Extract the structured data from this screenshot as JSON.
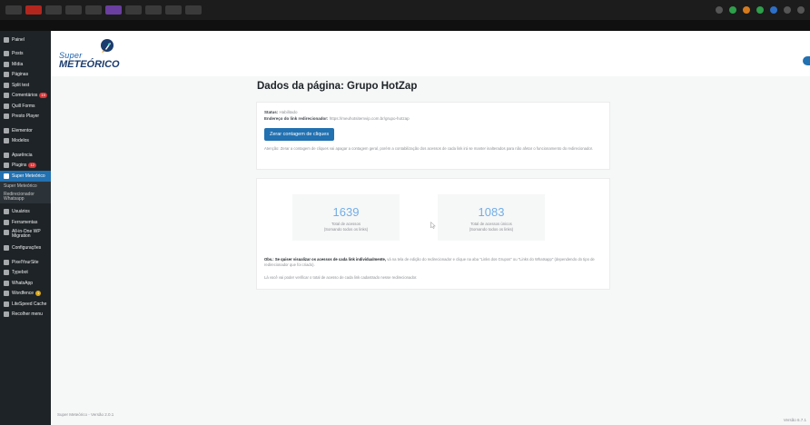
{
  "sidebar": {
    "items": [
      {
        "label": "Painel",
        "icon": "dashboard-icon"
      },
      {
        "label": "Posts",
        "icon": "pin-icon"
      },
      {
        "label": "Mídia",
        "icon": "media-icon"
      },
      {
        "label": "Páginas",
        "icon": "pages-icon"
      },
      {
        "label": "Split test",
        "icon": "split-icon"
      },
      {
        "label": "Comentários",
        "icon": "comment-icon",
        "badge": "19"
      },
      {
        "label": "Quill Forms",
        "icon": "form-icon"
      },
      {
        "label": "Presto Player",
        "icon": "play-icon"
      },
      {
        "label": "Elementor",
        "icon": "elementor-icon"
      },
      {
        "label": "Modelos",
        "icon": "folder-icon"
      },
      {
        "label": "Aparência",
        "icon": "brush-icon"
      },
      {
        "label": "Plugins",
        "icon": "plugin-icon",
        "badge": "12"
      },
      {
        "label": "Super Meteórico",
        "icon": "rocket-icon"
      },
      {
        "label": "Super Meteórico"
      },
      {
        "label": "Redirecionador Whatsapp"
      },
      {
        "label": "Usuários",
        "icon": "users-icon"
      },
      {
        "label": "Ferramentas",
        "icon": "tools-icon"
      },
      {
        "label": "All-in-One WP Migration",
        "icon": "migration-icon"
      },
      {
        "label": "Configurações",
        "icon": "settings-icon"
      },
      {
        "label": "PixelYourSite",
        "icon": "pixel-icon"
      },
      {
        "label": "Typebot",
        "icon": "bot-icon"
      },
      {
        "label": "WhatsApp",
        "icon": "whatsapp-icon"
      },
      {
        "label": "Wordfence",
        "icon": "shield-icon",
        "badge": "1"
      },
      {
        "label": "LiteSpeed Cache",
        "icon": "speed-icon"
      },
      {
        "label": "Recolher menu",
        "icon": "collapse-icon"
      }
    ]
  },
  "logo": {
    "top": "Super",
    "bottom": "METEÓRICO"
  },
  "page": {
    "title_prefix": "Dados da página: ",
    "title_name": "Grupo HotZap"
  },
  "info": {
    "status_label": "Status:",
    "status_value": "Habilitado",
    "link_label": "Endereço do link redirecionador:",
    "link_value": "https://meuhotsitemvip.com.br/grupo-hotzap",
    "reset_button": "Zerar contagem de cliques",
    "warning": "Atenção: Zerar a contagem de cliques vai apagar a contagem geral, porém a contabilização dos acessos de cada link irá se manter inalterados para não afetar o funcionamento do redirecionador."
  },
  "stats": [
    {
      "value": "1639",
      "caption_line1": "Total de acessos",
      "caption_line2": "(Somando todos os links)"
    },
    {
      "value": "1083",
      "caption_line1": "Total de acessos únicos",
      "caption_line2": "(Somando todos os links)"
    }
  ],
  "notes": {
    "note1_bold": "Obs.: Se quiser visualizar os acessos de cada link individualmente,",
    "note1_rest": " vá na tela de edição do redirecionador e clique na aba \"Links dos Grupos\" ou \"Links do Whatsapp\" (dependendo do tipo de redirecionador que foi criado).",
    "note2": "Lá você vai poder verificar o total de acesso de cada link cadastrado nesse redirecionador."
  },
  "footer": {
    "left": "Super Meteórico - Versão 2.0.1",
    "right": "Versão 6.7.1"
  },
  "colors": {
    "primary": "#2271b1",
    "sidebar": "#1d2327",
    "stat_number": "#72aee6"
  }
}
